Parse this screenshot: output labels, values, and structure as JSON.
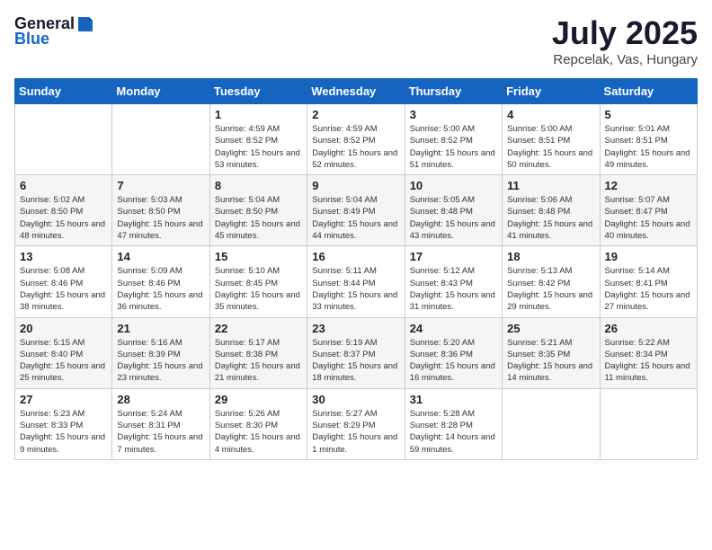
{
  "header": {
    "logo_general": "General",
    "logo_blue": "Blue",
    "month": "July 2025",
    "location": "Repcelak, Vas, Hungary"
  },
  "weekdays": [
    "Sunday",
    "Monday",
    "Tuesday",
    "Wednesday",
    "Thursday",
    "Friday",
    "Saturday"
  ],
  "weeks": [
    [
      {
        "day": "",
        "info": ""
      },
      {
        "day": "",
        "info": ""
      },
      {
        "day": "1",
        "info": "Sunrise: 4:59 AM\nSunset: 8:52 PM\nDaylight: 15 hours and 53 minutes."
      },
      {
        "day": "2",
        "info": "Sunrise: 4:59 AM\nSunset: 8:52 PM\nDaylight: 15 hours and 52 minutes."
      },
      {
        "day": "3",
        "info": "Sunrise: 5:00 AM\nSunset: 8:52 PM\nDaylight: 15 hours and 51 minutes."
      },
      {
        "day": "4",
        "info": "Sunrise: 5:00 AM\nSunset: 8:51 PM\nDaylight: 15 hours and 50 minutes."
      },
      {
        "day": "5",
        "info": "Sunrise: 5:01 AM\nSunset: 8:51 PM\nDaylight: 15 hours and 49 minutes."
      }
    ],
    [
      {
        "day": "6",
        "info": "Sunrise: 5:02 AM\nSunset: 8:50 PM\nDaylight: 15 hours and 48 minutes."
      },
      {
        "day": "7",
        "info": "Sunrise: 5:03 AM\nSunset: 8:50 PM\nDaylight: 15 hours and 47 minutes."
      },
      {
        "day": "8",
        "info": "Sunrise: 5:04 AM\nSunset: 8:50 PM\nDaylight: 15 hours and 45 minutes."
      },
      {
        "day": "9",
        "info": "Sunrise: 5:04 AM\nSunset: 8:49 PM\nDaylight: 15 hours and 44 minutes."
      },
      {
        "day": "10",
        "info": "Sunrise: 5:05 AM\nSunset: 8:48 PM\nDaylight: 15 hours and 43 minutes."
      },
      {
        "day": "11",
        "info": "Sunrise: 5:06 AM\nSunset: 8:48 PM\nDaylight: 15 hours and 41 minutes."
      },
      {
        "day": "12",
        "info": "Sunrise: 5:07 AM\nSunset: 8:47 PM\nDaylight: 15 hours and 40 minutes."
      }
    ],
    [
      {
        "day": "13",
        "info": "Sunrise: 5:08 AM\nSunset: 8:46 PM\nDaylight: 15 hours and 38 minutes."
      },
      {
        "day": "14",
        "info": "Sunrise: 5:09 AM\nSunset: 8:46 PM\nDaylight: 15 hours and 36 minutes."
      },
      {
        "day": "15",
        "info": "Sunrise: 5:10 AM\nSunset: 8:45 PM\nDaylight: 15 hours and 35 minutes."
      },
      {
        "day": "16",
        "info": "Sunrise: 5:11 AM\nSunset: 8:44 PM\nDaylight: 15 hours and 33 minutes."
      },
      {
        "day": "17",
        "info": "Sunrise: 5:12 AM\nSunset: 8:43 PM\nDaylight: 15 hours and 31 minutes."
      },
      {
        "day": "18",
        "info": "Sunrise: 5:13 AM\nSunset: 8:42 PM\nDaylight: 15 hours and 29 minutes."
      },
      {
        "day": "19",
        "info": "Sunrise: 5:14 AM\nSunset: 8:41 PM\nDaylight: 15 hours and 27 minutes."
      }
    ],
    [
      {
        "day": "20",
        "info": "Sunrise: 5:15 AM\nSunset: 8:40 PM\nDaylight: 15 hours and 25 minutes."
      },
      {
        "day": "21",
        "info": "Sunrise: 5:16 AM\nSunset: 8:39 PM\nDaylight: 15 hours and 23 minutes."
      },
      {
        "day": "22",
        "info": "Sunrise: 5:17 AM\nSunset: 8:38 PM\nDaylight: 15 hours and 21 minutes."
      },
      {
        "day": "23",
        "info": "Sunrise: 5:19 AM\nSunset: 8:37 PM\nDaylight: 15 hours and 18 minutes."
      },
      {
        "day": "24",
        "info": "Sunrise: 5:20 AM\nSunset: 8:36 PM\nDaylight: 15 hours and 16 minutes."
      },
      {
        "day": "25",
        "info": "Sunrise: 5:21 AM\nSunset: 8:35 PM\nDaylight: 15 hours and 14 minutes."
      },
      {
        "day": "26",
        "info": "Sunrise: 5:22 AM\nSunset: 8:34 PM\nDaylight: 15 hours and 11 minutes."
      }
    ],
    [
      {
        "day": "27",
        "info": "Sunrise: 5:23 AM\nSunset: 8:33 PM\nDaylight: 15 hours and 9 minutes."
      },
      {
        "day": "28",
        "info": "Sunrise: 5:24 AM\nSunset: 8:31 PM\nDaylight: 15 hours and 7 minutes."
      },
      {
        "day": "29",
        "info": "Sunrise: 5:26 AM\nSunset: 8:30 PM\nDaylight: 15 hours and 4 minutes."
      },
      {
        "day": "30",
        "info": "Sunrise: 5:27 AM\nSunset: 8:29 PM\nDaylight: 15 hours and 1 minute."
      },
      {
        "day": "31",
        "info": "Sunrise: 5:28 AM\nSunset: 8:28 PM\nDaylight: 14 hours and 59 minutes."
      },
      {
        "day": "",
        "info": ""
      },
      {
        "day": "",
        "info": ""
      }
    ]
  ]
}
